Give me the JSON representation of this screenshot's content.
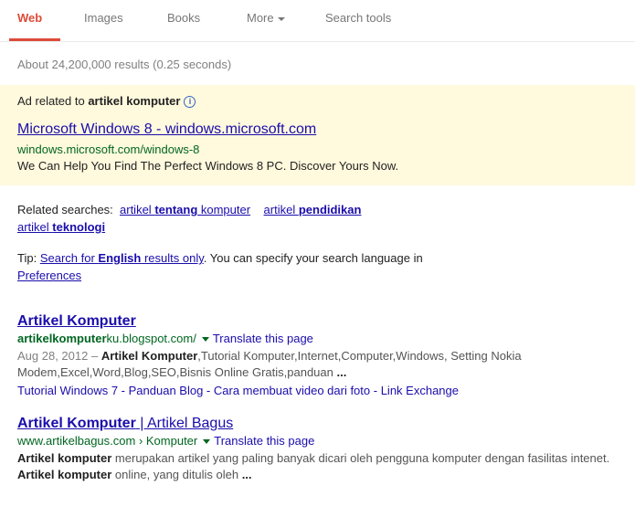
{
  "tabs": [
    {
      "label": "Web",
      "active": true
    },
    {
      "label": "Images",
      "active": false
    },
    {
      "label": "Books",
      "active": false
    },
    {
      "label": "More",
      "active": false
    },
    {
      "label": "Search tools",
      "active": false
    }
  ],
  "stats": "About 24,200,000 results (0.25 seconds)",
  "ad": {
    "label_prefix": "Ad related to ",
    "label_query": "artikel komputer",
    "info_icon": "i",
    "title": "Microsoft Windows 8 - windows.microsoft.com",
    "url": "windows.microsoft.com/windows-8",
    "description": "We Can Help You Find The Perfect Windows 8 PC. Discover Yours Now."
  },
  "related": {
    "label": "Related searches:",
    "items": [
      {
        "plain": "artikel ",
        "bold": "tentang",
        "after": " komputer"
      },
      {
        "plain": "artikel ",
        "bold": "pendidikan",
        "after": ""
      },
      {
        "plain": "artikel ",
        "bold": "teknologi",
        "after": ""
      }
    ]
  },
  "tip": {
    "prefix": "Tip: ",
    "link_plain": "Search for ",
    "link_bold": "English",
    "link_after": " results only",
    "middle": ". You can specify your search language in ",
    "preferences": "Preferences"
  },
  "results": [
    {
      "title_bold": "Artikel Komputer",
      "title_rest": "",
      "url_bold": "artikelkomputer",
      "url_rest": "ku.blogspot.com/",
      "translate": "Translate this page",
      "date": "Aug 28, 2012 – ",
      "snippet_bold1": "Artikel Komputer",
      "snippet_text1": ",Tutorial Komputer,Internet,Computer,Windows, Setting Nokia Modem,Excel,Word,Blog,SEO,Bisnis Online Gratis,panduan ",
      "snippet_ellipsis": "...",
      "sitelinks": [
        "Tutorial Windows 7",
        "Panduan Blog",
        "Cara membuat video dari foto",
        "Link Exchange"
      ],
      "separator": " - "
    },
    {
      "title_bold": "Artikel Komputer",
      "title_rest": " | Artikel Bagus",
      "url_bold": "",
      "url_rest": "www.artikelbagus.com › Komputer",
      "translate": "Translate this page",
      "snippet_bold1": "Artikel komputer",
      "snippet_text1": " merupakan artikel yang paling banyak dicari oleh pengguna komputer dengan fasilitas intenet. ",
      "snippet_bold2": "Artikel komputer",
      "snippet_text2": " online, yang ditulis oleh ",
      "snippet_ellipsis": "..."
    }
  ]
}
